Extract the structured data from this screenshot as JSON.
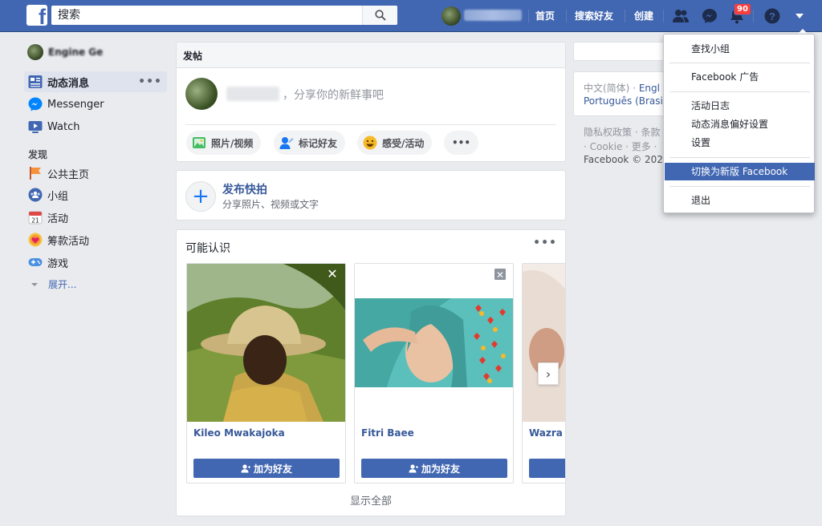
{
  "header": {
    "logo": "f",
    "search_placeholder": "搜索",
    "nav": [
      "首页",
      "搜索好友",
      "创建"
    ],
    "notification_count": "90"
  },
  "sidebar": {
    "username": "Engine Ge",
    "items": [
      {
        "label": "动态消息",
        "icon": "news-feed-icon",
        "dots": "•••"
      },
      {
        "label": "Messenger",
        "icon": "messenger-icon"
      },
      {
        "label": "Watch",
        "icon": "watch-icon"
      }
    ],
    "section_title": "发现",
    "explore": [
      {
        "label": "公共主页",
        "icon": "flag-icon"
      },
      {
        "label": "小组",
        "icon": "groups-icon"
      },
      {
        "label": "活动",
        "icon": "calendar-icon"
      },
      {
        "label": "筹款活动",
        "icon": "fundraiser-icon"
      },
      {
        "label": "游戏",
        "icon": "gamepad-icon"
      }
    ],
    "expand": "展开..."
  },
  "composer": {
    "header": "发帖",
    "placeholder_suffix": "，分享你的新鲜事吧",
    "actions": [
      "照片/视频",
      "标记好友",
      "感受/活动"
    ],
    "more": "•••"
  },
  "story": {
    "title": "发布快拍",
    "subtitle": "分享照片、视频或文字"
  },
  "pymk": {
    "title": "可能认识",
    "more": "•••",
    "people": [
      {
        "name": "Kileo Mwakajoka",
        "button": "加为好友"
      },
      {
        "name": "Fitri Baee",
        "button": "加为好友"
      },
      {
        "name": "Wazra",
        "button": ""
      }
    ],
    "show_all": "显示全部"
  },
  "right": {
    "lang1_current": "中文(简体)",
    "lang1_sep": " · ",
    "lang1_next": "Engl",
    "lang2": "Português (Brasil",
    "footer1": "隐私权政策 · 条款",
    "footer2": "· Cookie · 更多 ·",
    "footer3": "Facebook © 202"
  },
  "menu": {
    "items": [
      "查找小组",
      "Facebook 广告",
      "活动日志",
      "动态消息偏好设置",
      "设置",
      "切换为新版 Facebook",
      "退出"
    ],
    "highlighted_index": 5
  },
  "colors": {
    "brand": "#4267b2",
    "link": "#365899",
    "badge": "#fa3e3e"
  }
}
